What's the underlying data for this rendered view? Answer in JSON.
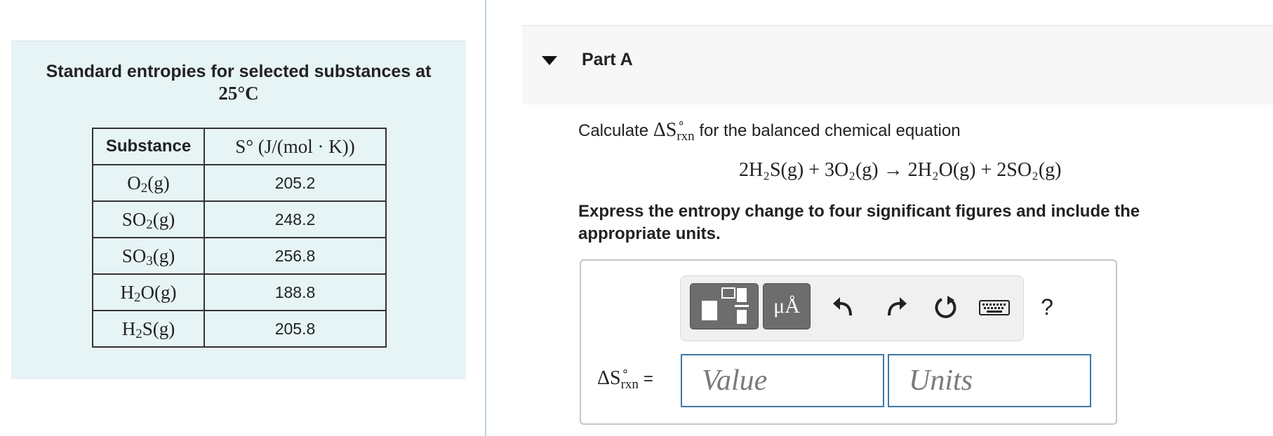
{
  "table": {
    "caption": "Standard entropies for selected substances at",
    "caption_temp": "25°C",
    "header_substance": "Substance",
    "header_entropy": "S° (J/(mol · K))",
    "rows": [
      {
        "substance": "O",
        "sub": "2",
        "substance_tail": "(g)",
        "value": "205.2"
      },
      {
        "substance": "SO",
        "sub": "2",
        "substance_tail": "(g)",
        "value": "248.2"
      },
      {
        "substance": "SO",
        "sub": "3",
        "substance_tail": "(g)",
        "value": "256.8"
      },
      {
        "substance": "H",
        "sub": "2",
        "substance_tail": "O(g)",
        "value": "188.8"
      },
      {
        "substance": "H",
        "sub": "2",
        "substance_tail": "S(g)",
        "value": "205.8"
      }
    ]
  },
  "part": {
    "title": "Part A",
    "question_prefix": "Calculate",
    "delta_s": "ΔS",
    "rxn": "rxn",
    "deg": "∘",
    "question_suffix": "for the balanced chemical equation",
    "equation": "2H₂S(g) + 3O₂(g) → 2H₂O(g) + 2SO₂(g)",
    "instructions": "Express the entropy change to four significant figures and include the appropriate units."
  },
  "toolbar": {
    "units_label": "μÅ",
    "help_label": "?",
    "icons": [
      "templates-icon",
      "units-icon",
      "undo-icon",
      "redo-icon",
      "reset-icon",
      "keyboard-icon",
      "help-icon"
    ]
  },
  "answer": {
    "equals": "=",
    "value_placeholder": "Value",
    "units_placeholder": "Units"
  },
  "colors": {
    "panel_bg": "#e7f4f5",
    "input_border": "#3d78a6",
    "button_bg": "#6d6d6d"
  }
}
